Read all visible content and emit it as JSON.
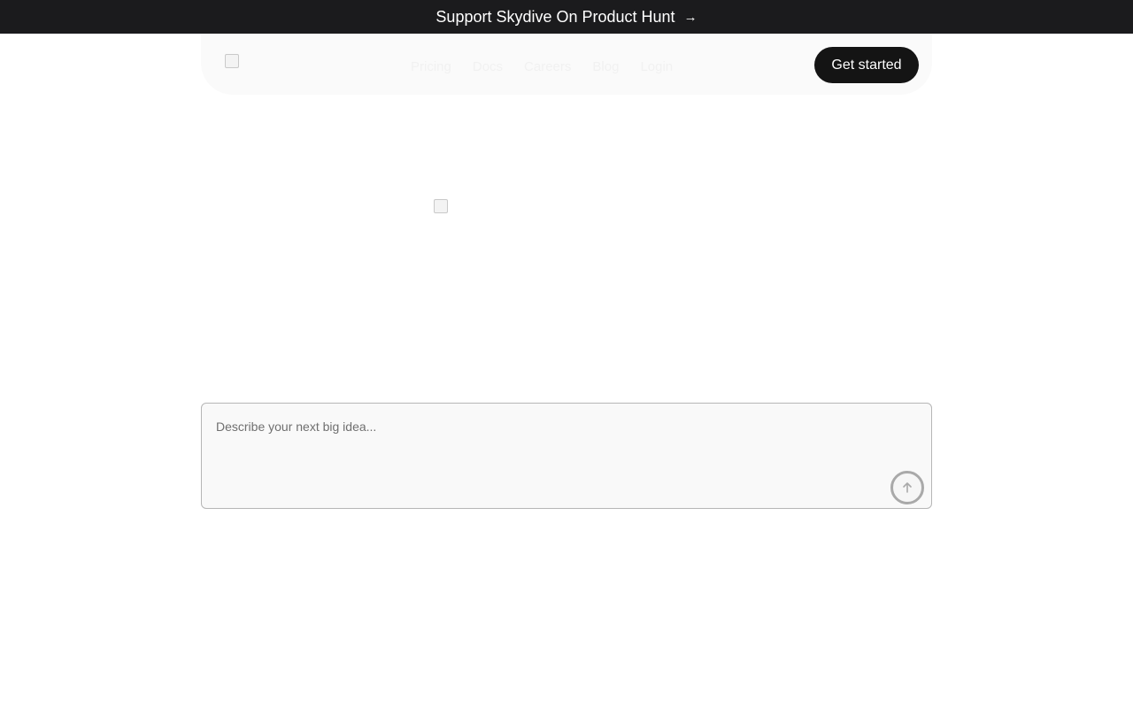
{
  "banner": {
    "text": "Support Skydive On Product Hunt",
    "arrow": "→"
  },
  "nav": {
    "links": [
      "Pricing",
      "Docs",
      "Careers",
      "Blog",
      "Login"
    ],
    "cta_label": "Get started"
  },
  "prompt": {
    "placeholder": "Describe your next big idea...",
    "submit_icon": "arrow-up-icon"
  }
}
